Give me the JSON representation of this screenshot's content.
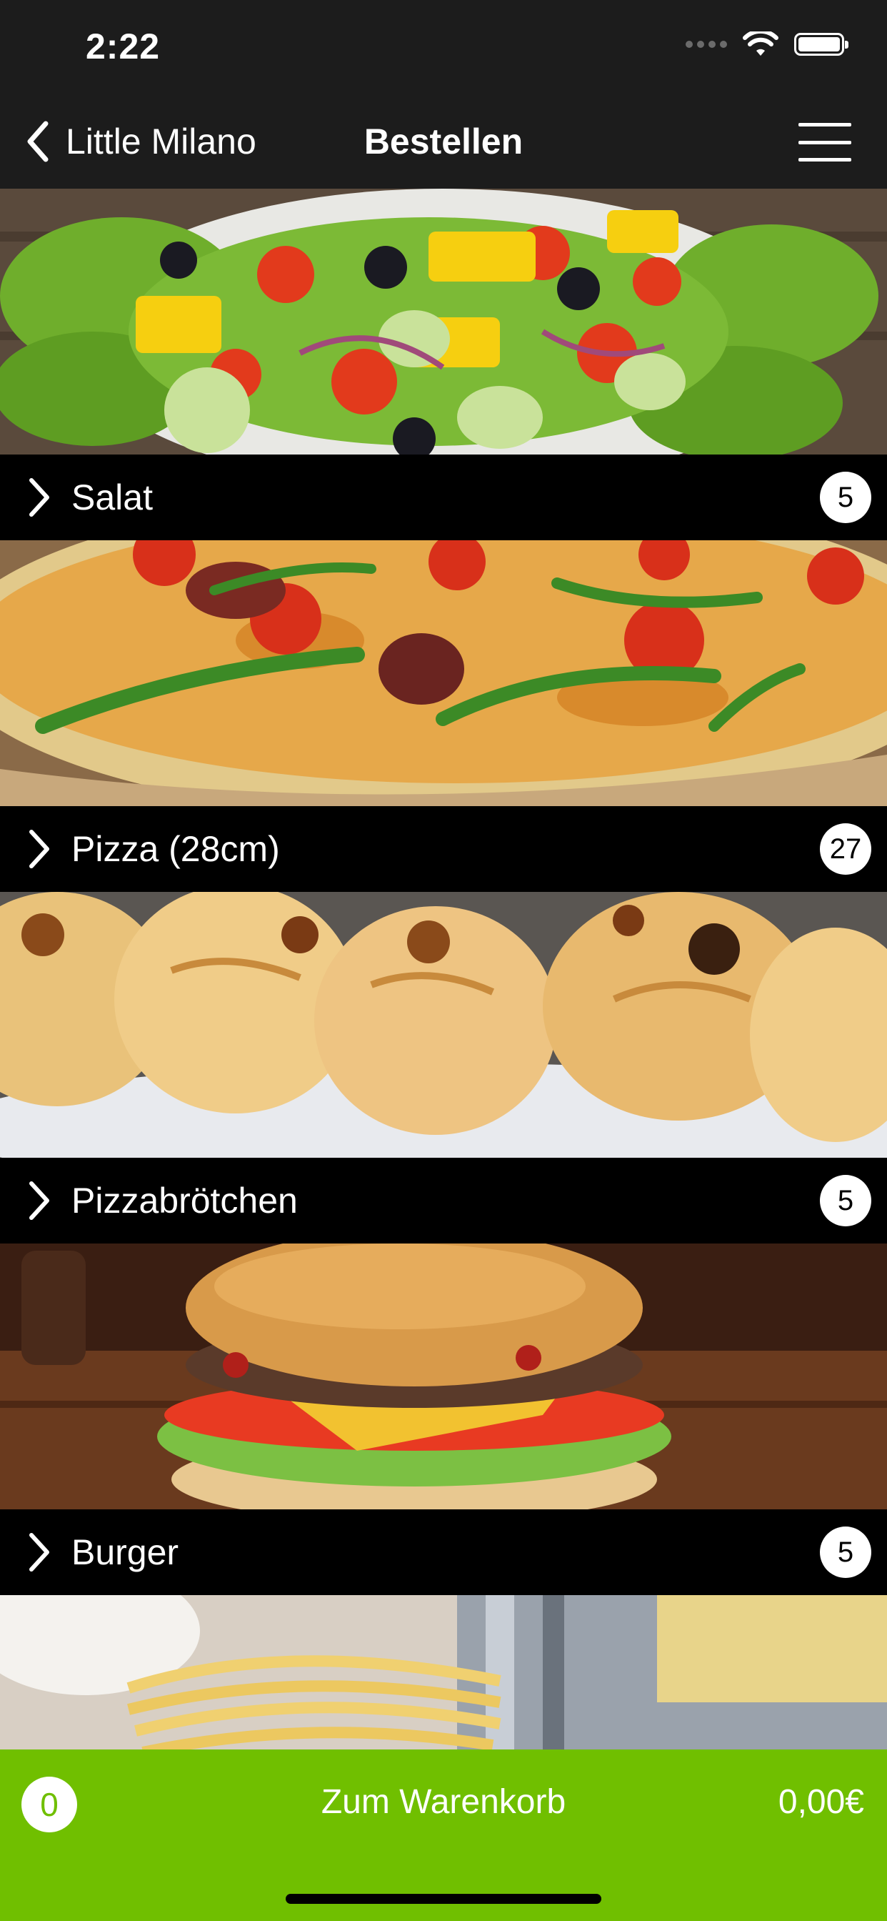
{
  "status_bar": {
    "time": "2:22"
  },
  "nav": {
    "back_label": "Little Milano",
    "title": "Bestellen"
  },
  "categories": [
    {
      "label": "Salat",
      "count": "5"
    },
    {
      "label": "Pizza (28cm)",
      "count": "27"
    },
    {
      "label": "Pizzabrötchen",
      "count": "5"
    },
    {
      "label": "Burger",
      "count": "5"
    }
  ],
  "cart": {
    "count": "0",
    "label": "Zum Warenkorb",
    "total": "0,00€"
  },
  "colors": {
    "bar_background": "#1c1c1c",
    "cart_green": "#70bf00"
  }
}
